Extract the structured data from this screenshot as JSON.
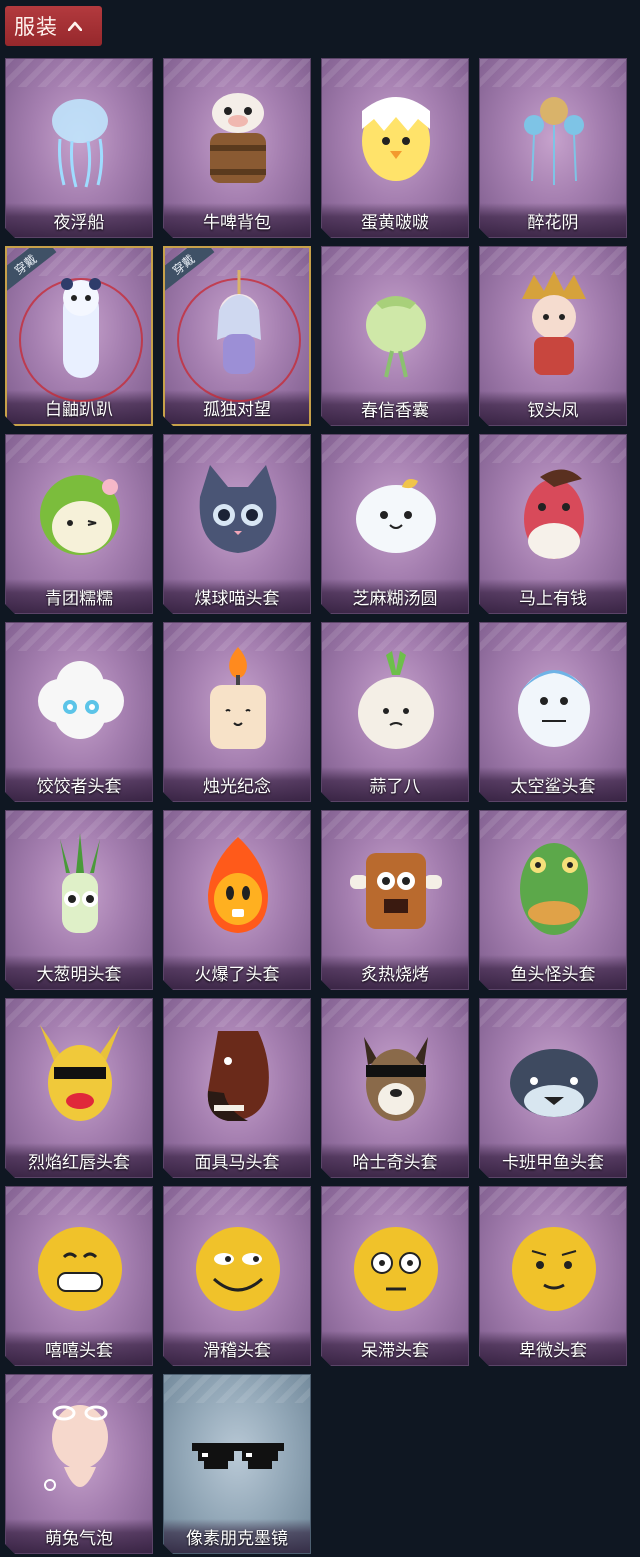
{
  "header": {
    "title": "服装"
  },
  "badge_text": "穿戴",
  "items": [
    {
      "name": "夜浮船",
      "icon": "jellyfish-icon",
      "equipped": false,
      "style": "purple"
    },
    {
      "name": "牛啤背包",
      "icon": "cow-beer-barrel-icon",
      "equipped": false,
      "style": "purple"
    },
    {
      "name": "蛋黄啵啵",
      "icon": "egg-chick-icon",
      "equipped": false,
      "style": "purple"
    },
    {
      "name": "醉花阴",
      "icon": "flower-ornament-icon",
      "equipped": false,
      "style": "purple"
    },
    {
      "name": "白鼬趴趴",
      "icon": "white-weasel-icon",
      "equipped": true,
      "style": "purple"
    },
    {
      "name": "孤独对望",
      "icon": "doll-charm-icon",
      "equipped": true,
      "style": "purple"
    },
    {
      "name": "春信香囊",
      "icon": "sachet-icon",
      "equipped": false,
      "style": "purple"
    },
    {
      "name": "钗头凤",
      "icon": "phoenix-crown-doll-icon",
      "equipped": false,
      "style": "purple"
    },
    {
      "name": "青团糯糯",
      "icon": "green-dumpling-head-icon",
      "equipped": false,
      "style": "purple"
    },
    {
      "name": "煤球喵头套",
      "icon": "cat-head-icon",
      "equipped": false,
      "style": "purple"
    },
    {
      "name": "芝麻糊汤圆",
      "icon": "tangyuan-head-icon",
      "equipped": false,
      "style": "purple"
    },
    {
      "name": "马上有钱",
      "icon": "horse-head-icon",
      "equipped": false,
      "style": "purple"
    },
    {
      "name": "饺饺者头套",
      "icon": "cloud-dumpling-head-icon",
      "equipped": false,
      "style": "purple"
    },
    {
      "name": "烛光纪念",
      "icon": "candle-head-icon",
      "equipped": false,
      "style": "purple"
    },
    {
      "name": "蒜了八",
      "icon": "garlic-head-icon",
      "equipped": false,
      "style": "purple"
    },
    {
      "name": "太空鲨头套",
      "icon": "shark-head-icon",
      "equipped": false,
      "style": "purple"
    },
    {
      "name": "大葱明头套",
      "icon": "scallion-head-icon",
      "equipped": false,
      "style": "purple"
    },
    {
      "name": "火爆了头套",
      "icon": "fire-head-icon",
      "equipped": false,
      "style": "purple"
    },
    {
      "name": "炙热烧烤",
      "icon": "bbq-meat-head-icon",
      "equipped": false,
      "style": "purple"
    },
    {
      "name": "鱼头怪头套",
      "icon": "fish-monster-head-icon",
      "equipped": false,
      "style": "purple"
    },
    {
      "name": "烈焰红唇头套",
      "icon": "yellow-mouse-sunglasses-icon",
      "equipped": false,
      "style": "purple"
    },
    {
      "name": "面具马头套",
      "icon": "horse-mask-icon",
      "equipped": false,
      "style": "purple"
    },
    {
      "name": "哈士奇头套",
      "icon": "husky-head-icon",
      "equipped": false,
      "style": "purple"
    },
    {
      "name": "卡班甲鱼头套",
      "icon": "whale-head-icon",
      "equipped": false,
      "style": "purple"
    },
    {
      "name": "嘻嘻头套",
      "icon": "grin-emoji-icon",
      "equipped": false,
      "style": "purple"
    },
    {
      "name": "滑稽头套",
      "icon": "smirk-emoji-icon",
      "equipped": false,
      "style": "purple"
    },
    {
      "name": "呆滞头套",
      "icon": "dazed-emoji-icon",
      "equipped": false,
      "style": "purple"
    },
    {
      "name": "卑微头套",
      "icon": "humble-emoji-icon",
      "equipped": false,
      "style": "purple"
    },
    {
      "name": "萌兔气泡",
      "icon": "bubble-bunny-icon",
      "equipped": false,
      "style": "purple"
    },
    {
      "name": "像素朋克墨镜",
      "icon": "pixel-sunglasses-icon",
      "equipped": false,
      "style": "blue"
    }
  ]
}
